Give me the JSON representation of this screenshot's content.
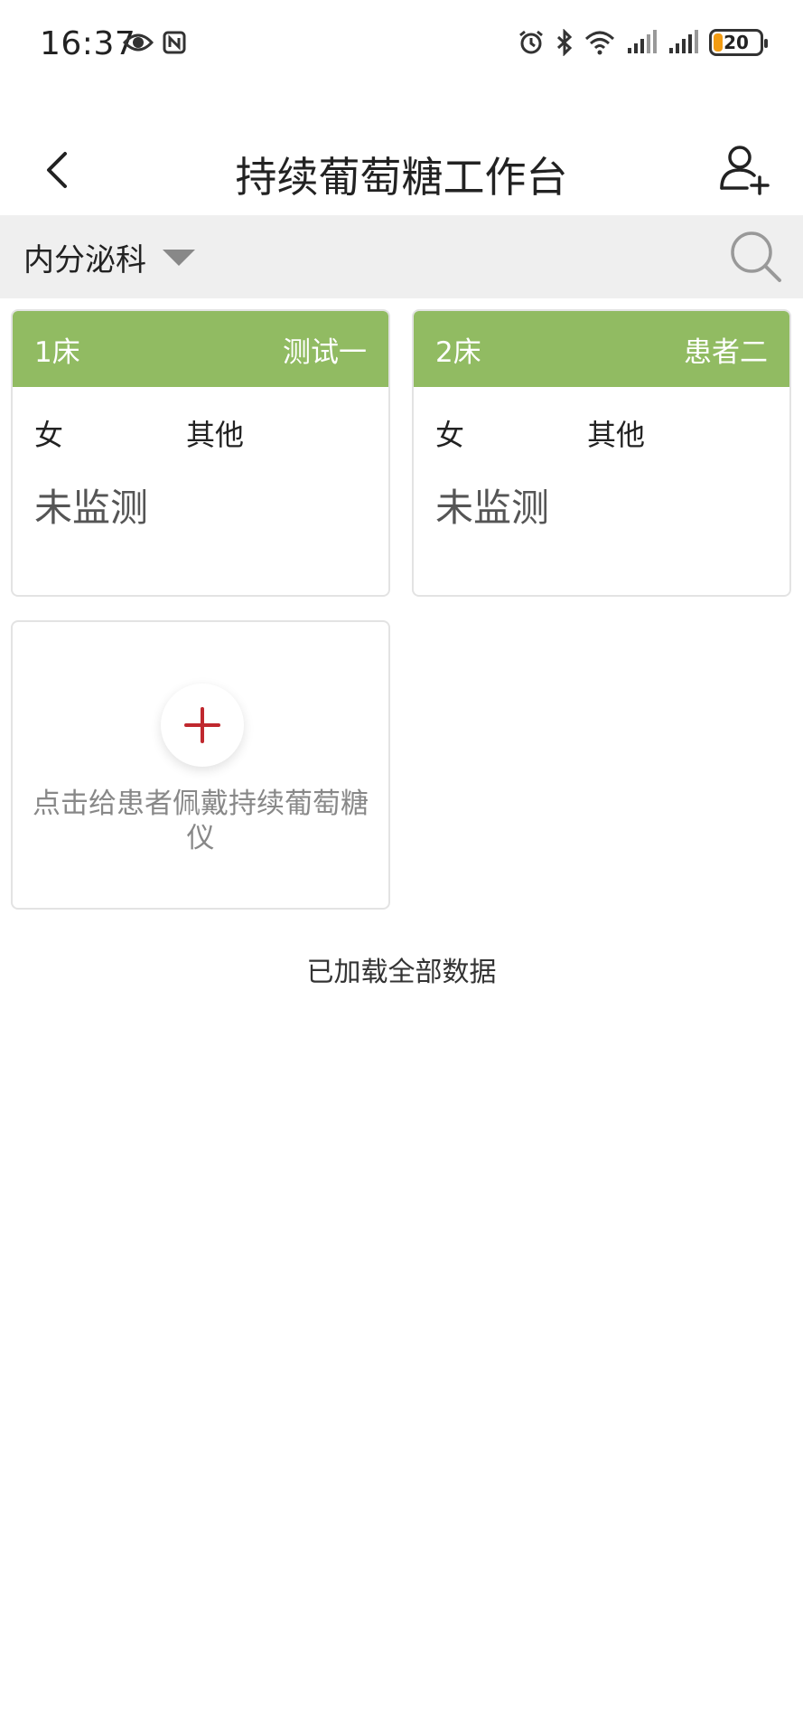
{
  "status_bar": {
    "time": "16:37",
    "battery": "20",
    "icons": [
      "eye-icon",
      "nfc-icon",
      "alarm-icon",
      "bluetooth-icon",
      "wifi-icon",
      "signal-icon",
      "signal-icon"
    ]
  },
  "header": {
    "title": "持续葡萄糖工作台",
    "back_icon": "chevron-left-icon",
    "add_user_icon": "add-user-icon"
  },
  "filter": {
    "department": "内分泌科",
    "search_icon": "search-icon"
  },
  "beds": [
    {
      "bed": "1床",
      "name": "测试一",
      "gender": "女",
      "type": "其他",
      "status": "未监测"
    },
    {
      "bed": "2床",
      "name": "患者二",
      "gender": "女",
      "type": "其他",
      "status": "未监测"
    }
  ],
  "add_card": {
    "text": "点击给患者佩戴持续葡萄糖仪"
  },
  "footer": {
    "load_message": "已加载全部数据"
  },
  "colors": {
    "card_header": "#91bb62",
    "add_plus": "#c0282e",
    "filter_bg": "#efefef",
    "battery": "#f39c12"
  }
}
